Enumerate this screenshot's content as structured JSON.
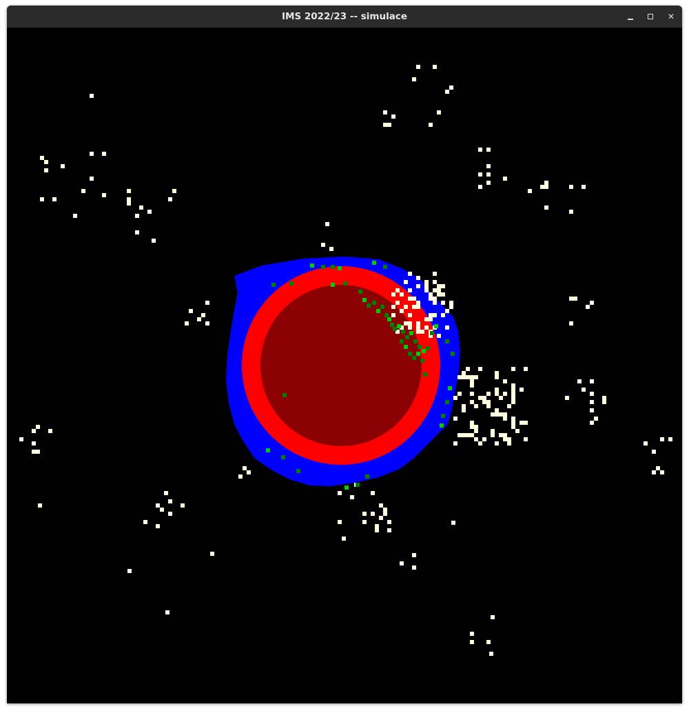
{
  "window": {
    "title": "IMS 2022/23 -- simulace",
    "controls": {
      "minimize_icon": "minimize-icon",
      "maximize_icon": "maximize-icon",
      "close_icon": "close-icon",
      "close_glyph": "✕"
    }
  },
  "simulation": {
    "cell_colors": {
      "background": "#000000",
      "core": "#8b0000",
      "ring": "#ff0000",
      "outer": "#0000ff",
      "green_dark": "#008000",
      "green_light": "#00cc00",
      "particles": "#fffde0"
    }
  }
}
